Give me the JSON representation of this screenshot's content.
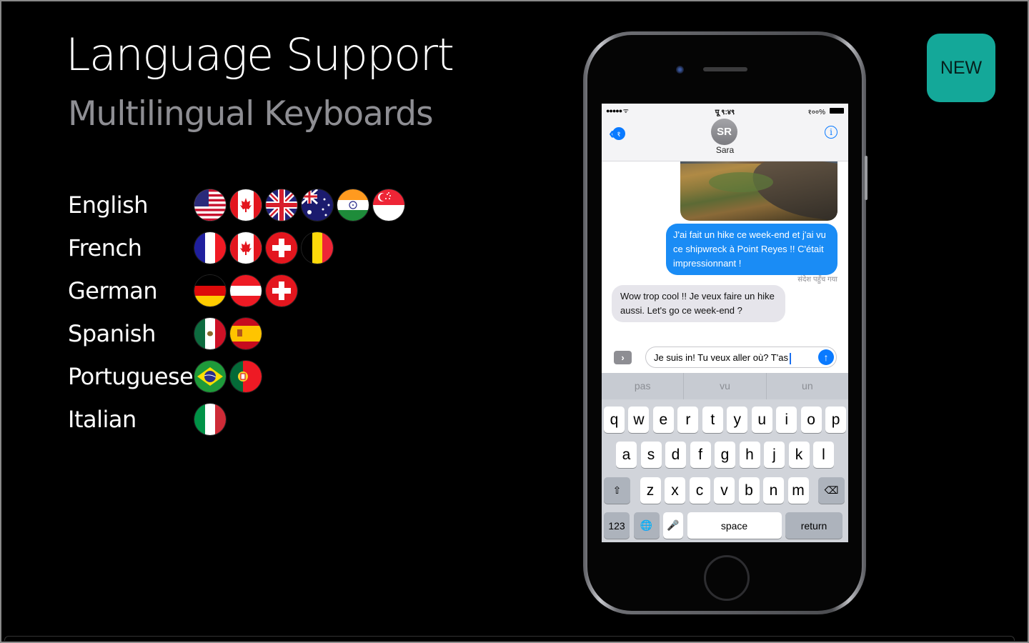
{
  "slide": {
    "title": "Language Support",
    "subtitle": "Multilingual Keyboards",
    "badge": "NEW",
    "badge_color": "#14a899"
  },
  "languages": [
    {
      "name": "English",
      "flags": [
        "united-states",
        "canada",
        "united-kingdom",
        "australia",
        "india",
        "singapore"
      ]
    },
    {
      "name": "French",
      "flags": [
        "france",
        "canada",
        "switzerland",
        "belgium"
      ]
    },
    {
      "name": "German",
      "flags": [
        "germany",
        "austria",
        "switzerland"
      ]
    },
    {
      "name": "Spanish",
      "flags": [
        "mexico",
        "spain"
      ]
    },
    {
      "name": "Portuguese",
      "flags": [
        "brazil",
        "portugal"
      ]
    },
    {
      "name": "Italian",
      "flags": [
        "italy"
      ]
    }
  ],
  "phone": {
    "status": {
      "signal": "●●●●● ᯤ",
      "time": "पू ९:४९",
      "battery": "१००%"
    },
    "nav": {
      "back_count": "१",
      "avatar_initials": "SR",
      "contact_name": "Sara",
      "info_icon": "i"
    },
    "messages": [
      {
        "direction": "outgoing",
        "text": "J'ai fait un hike ce week-end et j'ai vu ce shipwreck à Point Reyes !! C'était  impressionnant !"
      },
      {
        "direction": "incoming",
        "text": "Wow trop cool !! Je veux faire un hike aussi. Let's go ce week-end ?"
      }
    ],
    "delivered_label": "संदेश पहुँच गया",
    "input": {
      "value": "Je suis in! Tu veux aller où? T'as",
      "expand_icon": "›",
      "send_icon": "↑"
    },
    "keyboard": {
      "suggestions": [
        "pas",
        "vu",
        "un"
      ],
      "row1": [
        "q",
        "w",
        "e",
        "r",
        "t",
        "y",
        "u",
        "i",
        "o",
        "p"
      ],
      "row2": [
        "a",
        "s",
        "d",
        "f",
        "g",
        "h",
        "j",
        "k",
        "l"
      ],
      "row3": [
        "z",
        "x",
        "c",
        "v",
        "b",
        "n",
        "m"
      ],
      "shift_icon": "⇧",
      "delete_icon": "⌫",
      "numbers_label": "123",
      "globe_icon": "🌐",
      "mic_icon": "🎤",
      "space_label": "space",
      "return_label": "return"
    },
    "accent_color": "#0a7aff"
  }
}
